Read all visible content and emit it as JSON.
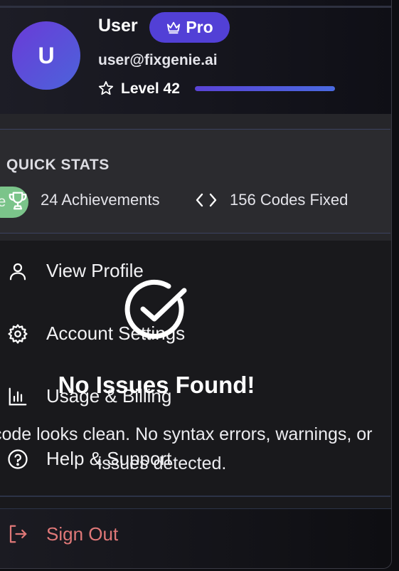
{
  "profile": {
    "avatar_initial": "U",
    "name": "User",
    "badge": "Pro",
    "email": "user@fixgenie.ai",
    "level": "Level 42",
    "level_progress": 1.0
  },
  "quick_stats": {
    "title": "QUICK STATS",
    "chip_text": "le",
    "achievements": "24 Achievements",
    "codes_fixed": "156 Codes Fixed"
  },
  "menu": {
    "items": [
      {
        "label": "View Profile",
        "icon": "user-icon"
      },
      {
        "label": "Account Settings",
        "icon": "gear-icon"
      },
      {
        "label": "Usage & Billing",
        "icon": "bar-chart-icon"
      },
      {
        "label": "Help & Support",
        "icon": "help-circle-icon"
      }
    ],
    "sign_out": "Sign Out"
  },
  "overlay": {
    "title": "No Issues Found!",
    "description": "Your code looks clean. No syntax errors, warnings, or issues detected."
  },
  "colors": {
    "accent": "#5240d6",
    "success_chip": "#7bc48a",
    "sign_out": "#e07878"
  }
}
